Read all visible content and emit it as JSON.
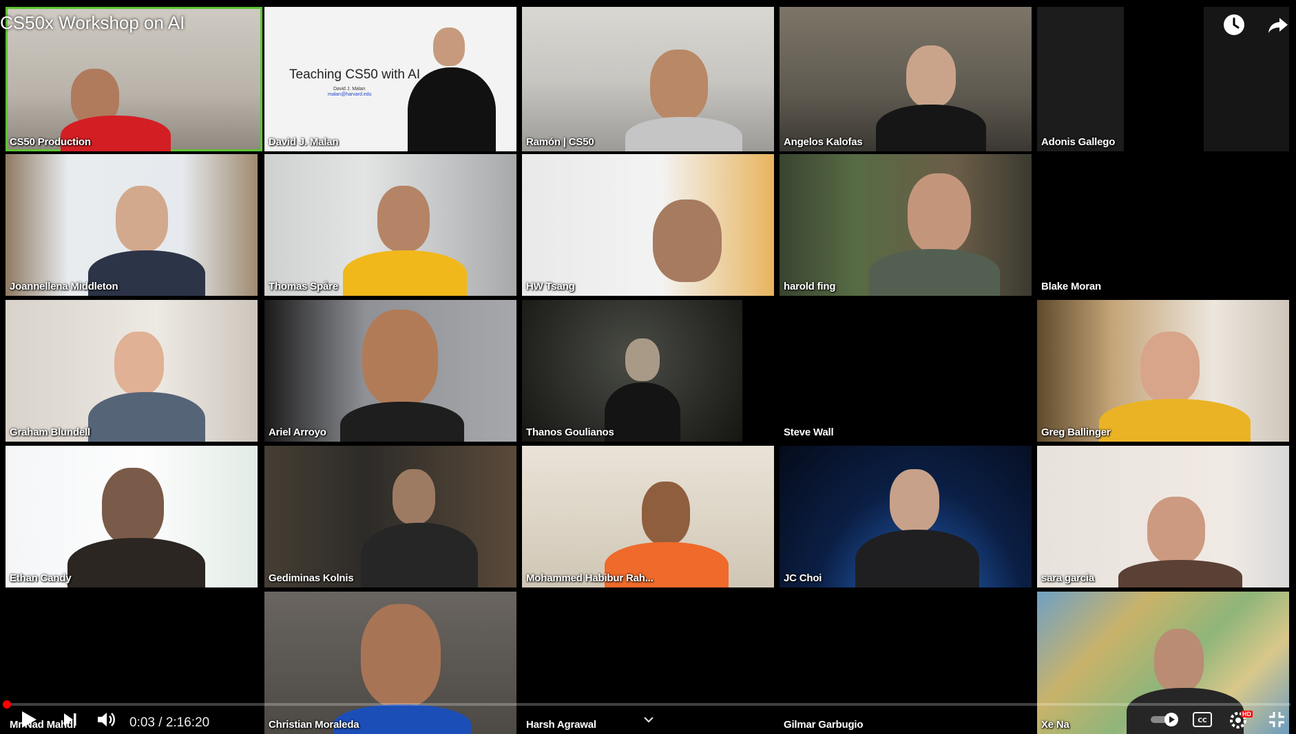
{
  "video": {
    "title": "CS50x Workshop on AI",
    "current_time": "0:03",
    "separator": "/",
    "duration": "2:16:20",
    "progress_fraction": 0.0004,
    "hd_badge": "HD"
  },
  "slide": {
    "title": "Teaching CS50 with AI",
    "subtitle": "David J. Malan",
    "email": "malan@harvard.edu"
  },
  "icons": {
    "watch_later": "clock-icon",
    "share": "share-arrow-icon",
    "play": "play-icon",
    "next": "skip-next-icon",
    "volume": "volume-icon",
    "autoplay": "autoplay-toggle-icon",
    "captions": "cc-icon",
    "settings": "gear-icon",
    "fullscreen": "fullscreen-exit-icon"
  },
  "colors": {
    "active_speaker": "#5cc433",
    "progress": "#ff0000"
  },
  "participants": [
    {
      "name": "CS50 Production"
    },
    {
      "name": "David J. Malan"
    },
    {
      "name": "Ramón | CS50"
    },
    {
      "name": "Angelos Kalofas"
    },
    {
      "name": "Adonis Gallego"
    },
    {
      "name": "Joannellena Middleton"
    },
    {
      "name": "Thomas Spåre"
    },
    {
      "name": "HW Tsang"
    },
    {
      "name": "harold fing"
    },
    {
      "name": "Blake Moran"
    },
    {
      "name": "Graham Blundell"
    },
    {
      "name": "Ariel Arroyo"
    },
    {
      "name": "Thanos Goulianos"
    },
    {
      "name": "Steve Wall"
    },
    {
      "name": "Greg Ballinger"
    },
    {
      "name": "Ethan Candy"
    },
    {
      "name": "Gediminas Kolnis"
    },
    {
      "name": "Mohammed Habibur Rah..."
    },
    {
      "name": "JC Choi"
    },
    {
      "name": "sara garcia"
    },
    {
      "name": "Mr Nad Mahdi"
    },
    {
      "name": "Christian Moraleda"
    },
    {
      "name": "Harsh Agrawal"
    },
    {
      "name": "Gilmar Garbugio"
    },
    {
      "name": "Xe Na"
    }
  ]
}
